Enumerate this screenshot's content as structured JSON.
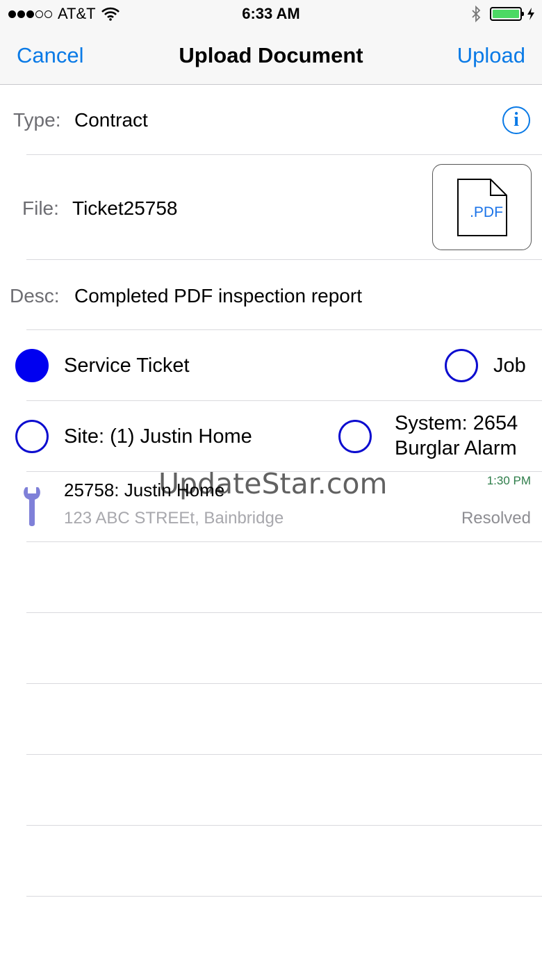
{
  "status_bar": {
    "carrier": "AT&T",
    "time": "6:33 AM",
    "signal_bars_filled": 3,
    "signal_bars_total": 5,
    "battery_level": 1.0
  },
  "nav": {
    "cancel": "Cancel",
    "title": "Upload Document",
    "upload": "Upload"
  },
  "form": {
    "type_label": "Type:",
    "type_value": "Contract",
    "file_label": "File:",
    "file_value": "Ticket25758",
    "file_icon_text": ".PDF",
    "desc_label": "Desc:",
    "desc_value": "Completed PDF inspection report"
  },
  "options": {
    "service_ticket": "Service Ticket",
    "job": "Job",
    "site": "Site: (1) Justin Home",
    "system_line1": "System: 2654",
    "system_line2": "Burglar Alarm"
  },
  "ticket": {
    "title": "25758: Justin Home",
    "address": "123 ABC STREEt, Bainbridge",
    "time": "1:30 PM",
    "status": "Resolved"
  },
  "watermark": "UpdateStar.com",
  "colors": {
    "accent": "#0a7ae6",
    "radio": "#0000f0",
    "wrench": "#7f80d8",
    "time_green": "#2e7d4a"
  },
  "icons": {
    "info": "info-icon",
    "pdf": "pdf-file-icon",
    "wrench": "wrench-icon"
  }
}
